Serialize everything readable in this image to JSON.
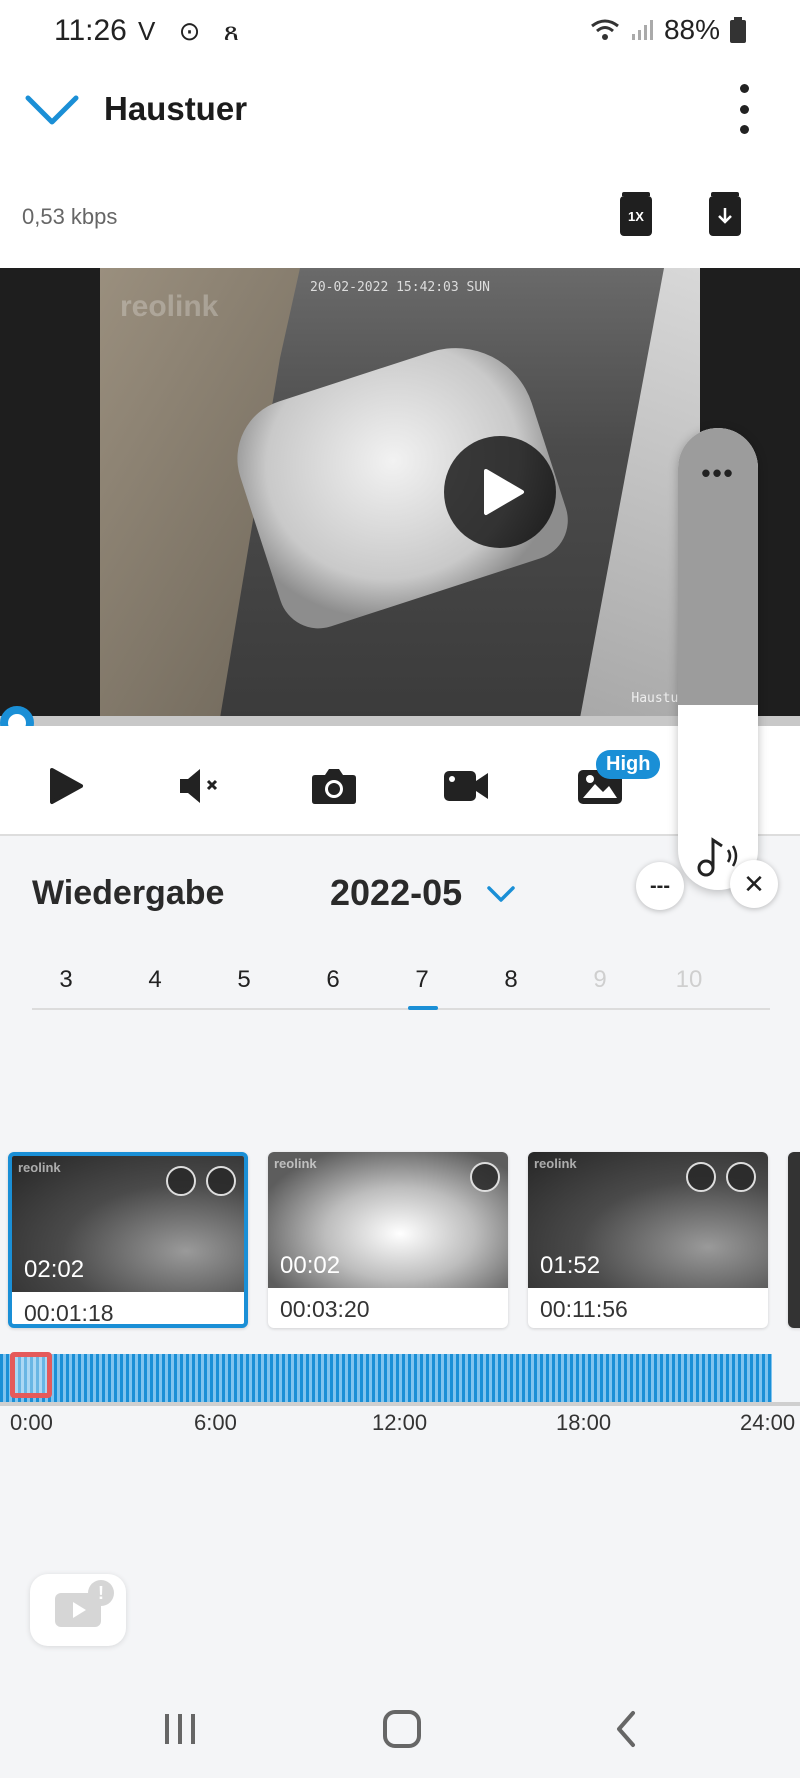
{
  "status_bar": {
    "time": "11:26",
    "left_icons": "V ⊙ ጸ",
    "battery": "88%"
  },
  "header": {
    "title": "Haustuer",
    "bitrate": "0,53 kbps",
    "speed_label": "1X"
  },
  "video": {
    "watermark": "reolink",
    "timestamp": "20-02-2022 15:42:03 SUN",
    "camera_name": "Haustuer"
  },
  "controls": {
    "quality_badge": "High"
  },
  "volume_popup": {
    "more": "•••",
    "level": 0.4
  },
  "playback": {
    "title": "Wiedergabe",
    "month": "2022-05",
    "collapse": "---",
    "close": "✕",
    "days": [
      "3",
      "4",
      "5",
      "6",
      "7",
      "8",
      "9",
      "10"
    ],
    "selected_day": "7"
  },
  "clips": [
    {
      "duration": "02:02",
      "start": "00:01:18",
      "selected": true
    },
    {
      "duration": "00:02",
      "start": "00:03:20",
      "selected": false
    },
    {
      "duration": "01:52",
      "start": "00:11:56",
      "selected": false
    }
  ],
  "timeline": {
    "ticks": [
      "0:00",
      "6:00",
      "12:00",
      "18:00",
      "24:00"
    ]
  },
  "fab": {
    "badge": "!"
  },
  "colors": {
    "accent": "#1a8fd6",
    "cursor": "#e55a5a"
  }
}
